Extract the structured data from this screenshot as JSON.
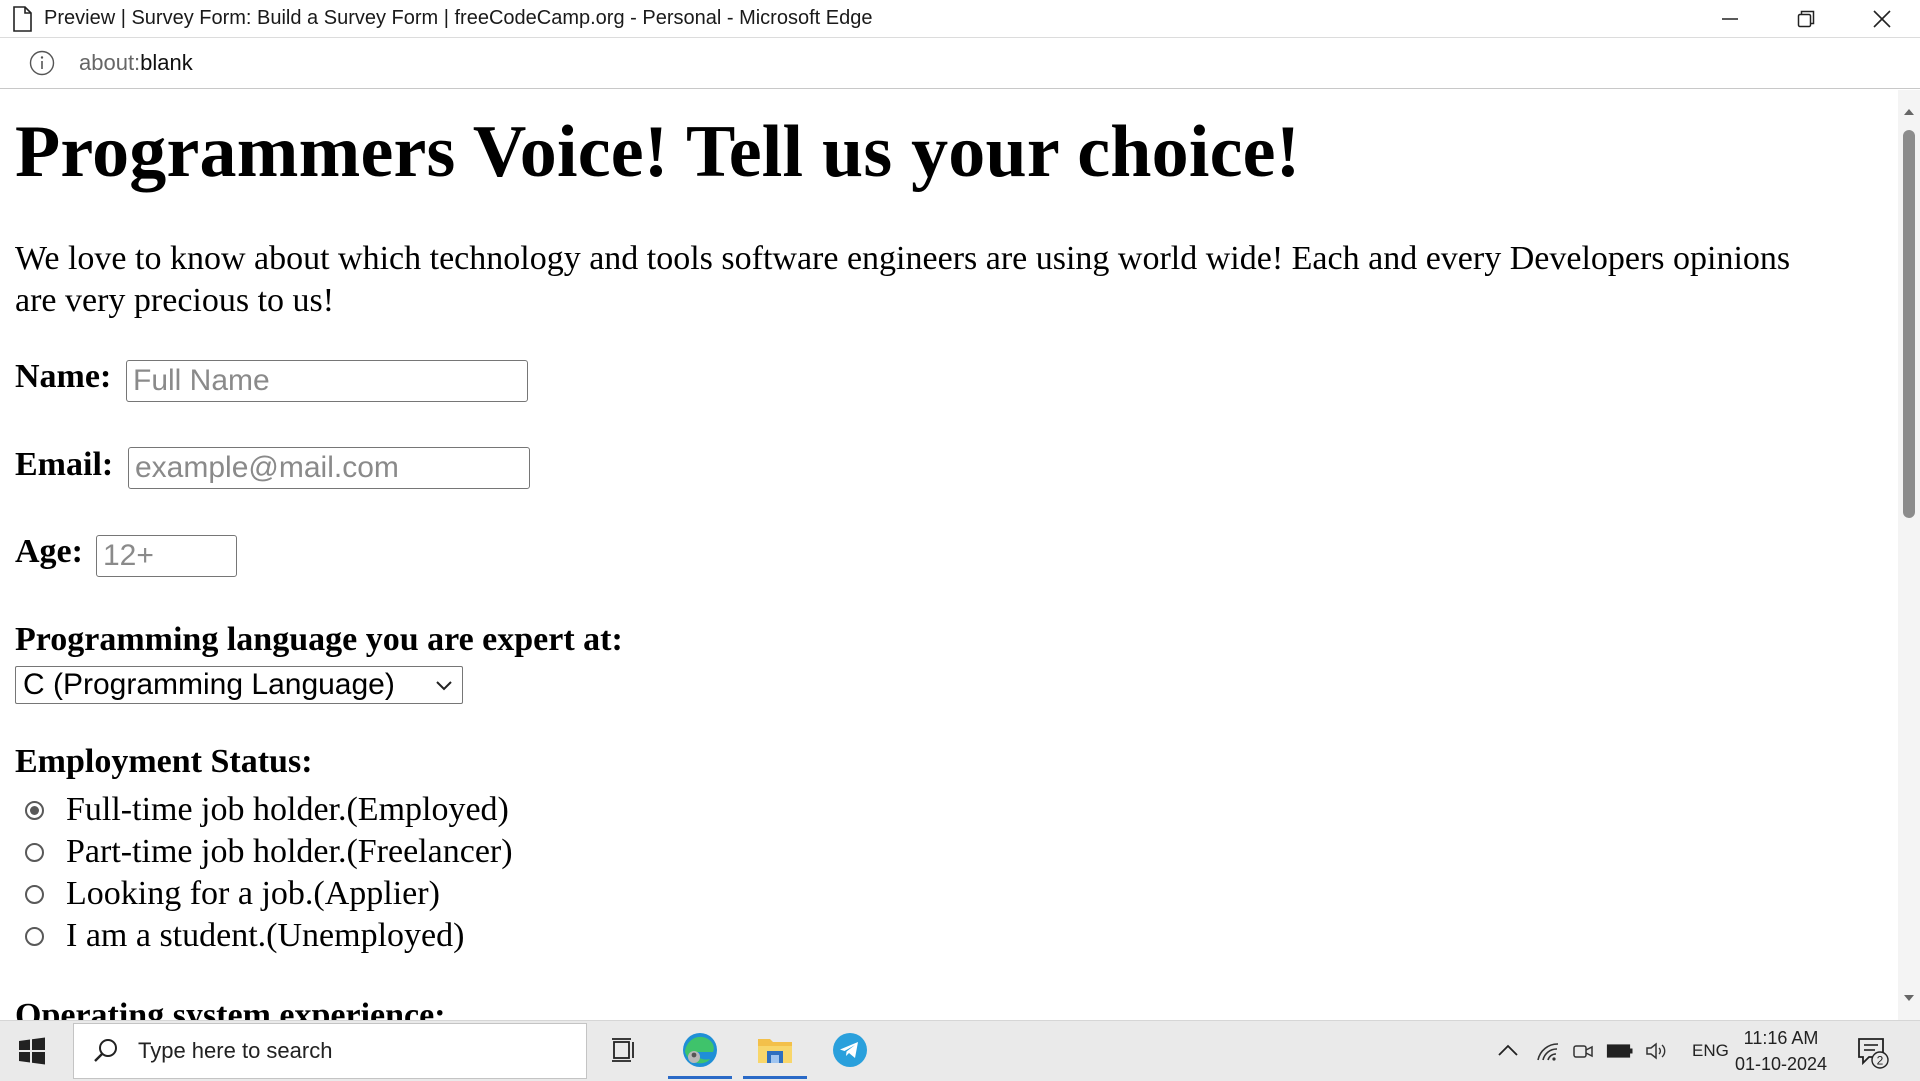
{
  "window": {
    "title": "Preview | Survey Form: Build a Survey Form | freeCodeCamp.org - Personal - Microsoft Edge",
    "controls": [
      "minimize-icon",
      "restore-icon",
      "close-icon"
    ]
  },
  "address_bar": {
    "icon": "info-icon",
    "url_scheme": "about:",
    "url_rest": "blank"
  },
  "page": {
    "heading": "Programmers Voice! Tell us your choice!",
    "description": "We love to know about which technology and tools software engineers are using world wide! Each and every Developers opinions are very precious to us!",
    "name_label": "Name:",
    "name_placeholder": "Full Name",
    "email_label": "Email:",
    "email_placeholder": "example@mail.com",
    "age_label": "Age:",
    "age_placeholder": "12+",
    "language_label": "Programming language you are expert at:",
    "language_selected": "C (Programming Language)",
    "employment_label": "Employment Status:",
    "employment_options": [
      {
        "label": "Full-time job holder.(Employed)",
        "checked": true
      },
      {
        "label": "Part-time job holder.(Freelancer)",
        "checked": false
      },
      {
        "label": "Looking for a job.(Applier)",
        "checked": false
      },
      {
        "label": "I am a student.(Unemployed)",
        "checked": false
      }
    ],
    "os_label": "Operating system experience:"
  },
  "taskbar": {
    "search_placeholder": "Type here to search",
    "apps": [
      "task-view-icon",
      "edge-icon",
      "file-explorer-icon",
      "telegram-icon"
    ],
    "language": "ENG",
    "time": "11:16 AM",
    "date": "01-10-2024",
    "notification_count": "2",
    "accent_color": "#2a6ac7"
  }
}
